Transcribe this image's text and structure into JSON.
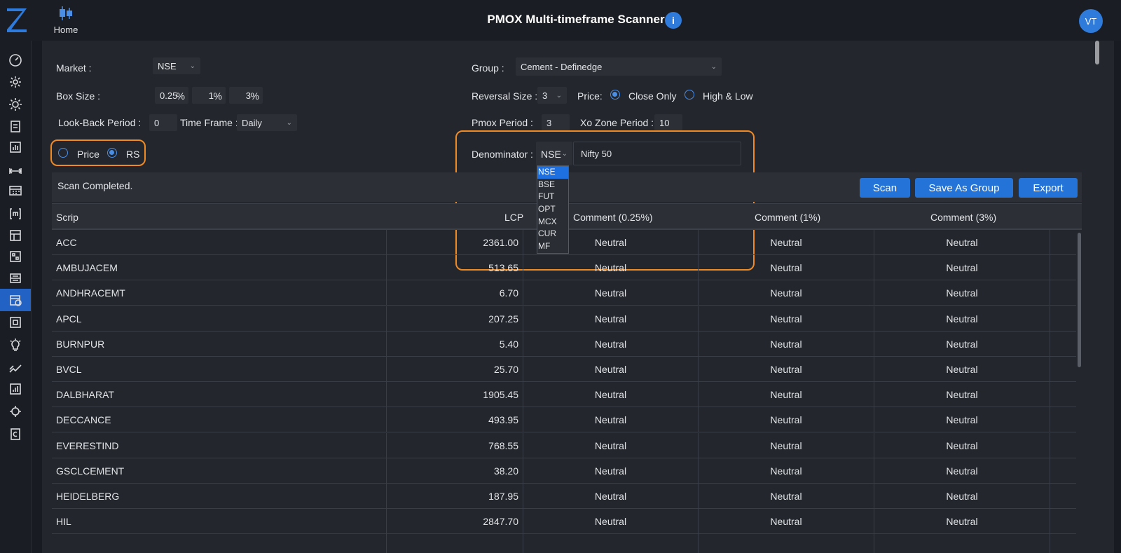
{
  "header": {
    "title": "PMOX Multi-timeframe Scanner",
    "home_label": "Home",
    "info_glyph": "i",
    "avatar_initials": "VT"
  },
  "sidebar": {
    "logo": "Z",
    "icons": [
      "dashboard-gauge-icon",
      "settings-cog-icon",
      "settings-gear-icon",
      "clipboard-list-icon",
      "chart-report-icon",
      "range-arrows-icon",
      "calendar-grid-icon",
      "bracket-m-icon",
      "window-panel-icon",
      "scan-qr-icon",
      "scanner-list-icon",
      "calendar-clock-icon",
      "focus-box-icon",
      "lightbulb-icon",
      "trend-lines-icon",
      "bar-chart-icon",
      "gear-refresh-icon",
      "clipboard-c-icon"
    ],
    "active_index": 11
  },
  "form": {
    "market_label": "Market :",
    "market_value": "NSE",
    "group_label": "Group :",
    "group_value": "Cement - Definedge",
    "box_size_label": "Box Size :",
    "box_sizes": [
      "0.25",
      "1",
      "3"
    ],
    "pct_symbol": "%",
    "reversal_label": "Reversal Size :",
    "reversal_value": "3",
    "price_label": "Price:",
    "close_only_label": "Close Only",
    "high_low_label": "High & Low",
    "price_mode": "Close Only",
    "lookback_label": "Look-Back Period :",
    "lookback_value": "0",
    "timeframe_label": "Time Frame :",
    "timeframe_value": "Daily",
    "pmox_label": "Pmox Period :",
    "pmox_value": "3",
    "xo_label": "Xo Zone Period :",
    "xo_value": "10",
    "mode_price_label": "Price",
    "mode_rs_label": "RS",
    "mode": "RS",
    "denominator_label": "Denominator :",
    "denominator_exchange": "NSE",
    "denominator_symbol": "Nifty 50"
  },
  "dropdown": {
    "options": [
      "NSE",
      "BSE",
      "FUT",
      "OPT",
      "MCX",
      "CUR",
      "MF"
    ],
    "selected": "NSE"
  },
  "toolbar": {
    "status": "Scan Completed.",
    "scan_label": "Scan",
    "save_group_label": "Save As Group",
    "export_label": "Export"
  },
  "table": {
    "columns": [
      "Scrip",
      "LCP",
      "Comment (0.25%)",
      "Comment (1%)",
      "Comment (3%)"
    ],
    "rows": [
      [
        "ACC",
        "2361.00",
        "Neutral",
        "Neutral",
        "Neutral"
      ],
      [
        "AMBUJACEM",
        "513.65",
        "Neutral",
        "Neutral",
        "Neutral"
      ],
      [
        "ANDHRACEMT",
        "6.70",
        "Neutral",
        "Neutral",
        "Neutral"
      ],
      [
        "APCL",
        "207.25",
        "Neutral",
        "Neutral",
        "Neutral"
      ],
      [
        "BURNPUR",
        "5.40",
        "Neutral",
        "Neutral",
        "Neutral"
      ],
      [
        "BVCL",
        "25.70",
        "Neutral",
        "Neutral",
        "Neutral"
      ],
      [
        "DALBHARAT",
        "1905.45",
        "Neutral",
        "Neutral",
        "Neutral"
      ],
      [
        "DECCANCE",
        "493.95",
        "Neutral",
        "Neutral",
        "Neutral"
      ],
      [
        "EVERESTIND",
        "768.55",
        "Neutral",
        "Neutral",
        "Neutral"
      ],
      [
        "GSCLCEMENT",
        "38.20",
        "Neutral",
        "Neutral",
        "Neutral"
      ],
      [
        "HEIDELBERG",
        "187.95",
        "Neutral",
        "Neutral",
        "Neutral"
      ],
      [
        "HIL",
        "2847.70",
        "Neutral",
        "Neutral",
        "Neutral"
      ],
      [
        "",
        "",
        "",
        "",
        ""
      ]
    ]
  },
  "colors": {
    "accent": "#2473d8",
    "highlight": "#f08a24",
    "background": "#181b21",
    "panel": "#23262c"
  }
}
